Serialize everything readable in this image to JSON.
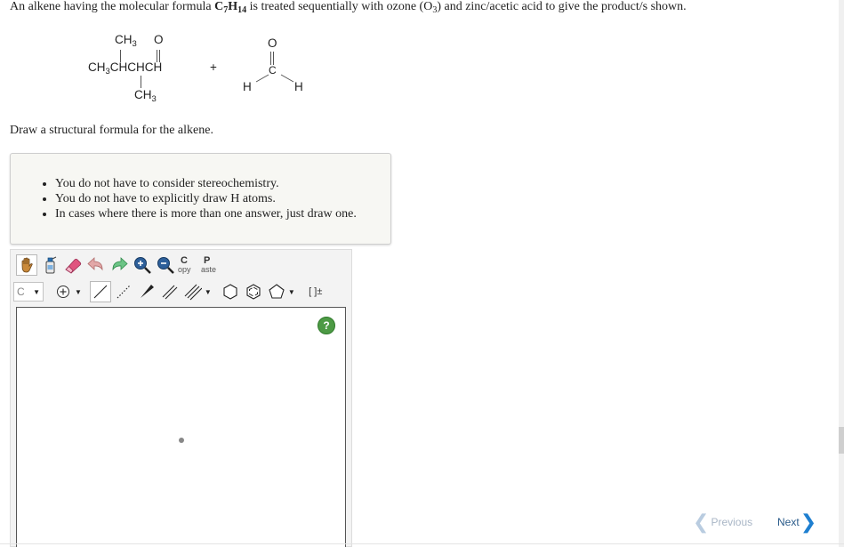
{
  "question": {
    "part1": "An alkene having the molecular formula ",
    "formula_c": "C",
    "formula_c_sub": "7",
    "formula_h": "H",
    "formula_h_sub": "14",
    "part2": " is treated sequentially with ozone (O",
    "ozone_sub": "3",
    "part3": ") and zinc/acetic acid to give the product/s shown."
  },
  "products": {
    "product1": {
      "top_ch3": "CH",
      "top_ch3_sub": "3",
      "top_o": "O",
      "main_a": "CH",
      "main_a_sub": "3",
      "main_b": "CHCHCH",
      "bottom_ch3": "CH",
      "bottom_ch3_sub": "3"
    },
    "plus": "+",
    "product2": {
      "o": "O",
      "c": "C",
      "h_left": "H",
      "h_right": "H"
    }
  },
  "instruction": "Draw a structural formula for the alkene.",
  "hints": [
    "You do not have to consider stereochemistry.",
    "You do not have to explicitly draw H atoms.",
    "In cases where there is more than one answer, just draw one."
  ],
  "toolbar": {
    "copy_big": "C",
    "copy_small": "opy",
    "paste_big": "P",
    "paste_small": "aste",
    "element_value": "C",
    "charge_label": "[ ]±",
    "tools_row1": [
      "hand-icon",
      "eraser-bottle-icon",
      "eraser-icon",
      "undo-icon",
      "redo-icon",
      "zoom-in-icon",
      "zoom-out-icon"
    ],
    "tools_row2": [
      "charge-icon",
      "single-bond-icon",
      "dashed-bond-icon",
      "wedge-bond-icon",
      "double-bond-icon",
      "triple-bond-icon",
      "cyclohexane-icon",
      "benzene-icon",
      "cyclopentane-icon"
    ]
  },
  "canvas": {
    "help": "?"
  },
  "nav": {
    "previous": "Previous",
    "next": "Next"
  },
  "colors": {
    "hint_bg": "#f7f7f3",
    "help_green": "#4d9a45",
    "next_blue": "#1e7fd0",
    "prev_disabled": "#b9cce0"
  }
}
